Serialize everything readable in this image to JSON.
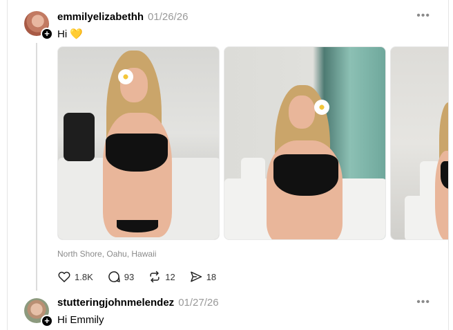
{
  "posts": [
    {
      "username": "emmilyelizabethh",
      "timestamp": "01/26/26",
      "text": "Hi 💛",
      "location": "North Shore, Oahu, Hawaii",
      "stats": {
        "likes": "1.8K",
        "replies": "93",
        "reposts": "12",
        "shares": "18"
      },
      "more_label": "•••",
      "follow_badge": "+"
    },
    {
      "username": "stutteringjohnmelendez",
      "timestamp": "01/27/26",
      "text": "Hi Emmily",
      "more_label": "•••",
      "follow_badge": "+"
    }
  ],
  "icons": {
    "like": "heart-icon",
    "reply": "comment-icon",
    "repost": "repost-icon",
    "share": "send-icon",
    "more": "more-dots-icon",
    "follow": "plus-icon"
  }
}
